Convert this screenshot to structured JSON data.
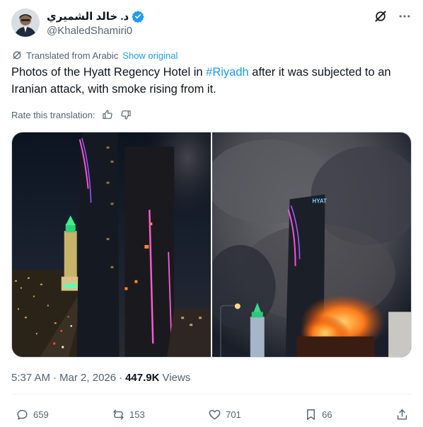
{
  "author": {
    "display_name": "د. خالد الشميري",
    "handle": "@KhaledShamiri0",
    "verified": true
  },
  "icons": {
    "verified": "verified-badge-icon",
    "grok": "grok-icon",
    "more": "more-icon",
    "translate": "translate-icon",
    "thumbs_up": "thumbs-up-icon",
    "thumbs_down": "thumbs-down-icon",
    "reply": "reply-icon",
    "repost": "repost-icon",
    "like": "heart-icon",
    "bookmark": "bookmark-icon",
    "share": "share-icon"
  },
  "translation": {
    "label": "Translated from Arabic",
    "show_original": "Show original",
    "rate_label": "Rate this translation:"
  },
  "tweet": {
    "text_before": "Photos of the Hyatt Regency Hotel in ",
    "hashtag": "#Riyadh",
    "text_after": " after it was subjected to an Iranian attack, with smoke rising from it."
  },
  "meta": {
    "time": "5:37 AM",
    "sep1": "·",
    "date": "Mar 2, 2026",
    "sep2": "·",
    "views_count": "447.9K",
    "views_label": "Views"
  },
  "stats": {
    "replies": "659",
    "reposts": "153",
    "likes": "701",
    "bookmarks": "66"
  },
  "colors": {
    "accent": "#1d9bf0",
    "text": "#0f1419",
    "secondary": "#536471"
  }
}
